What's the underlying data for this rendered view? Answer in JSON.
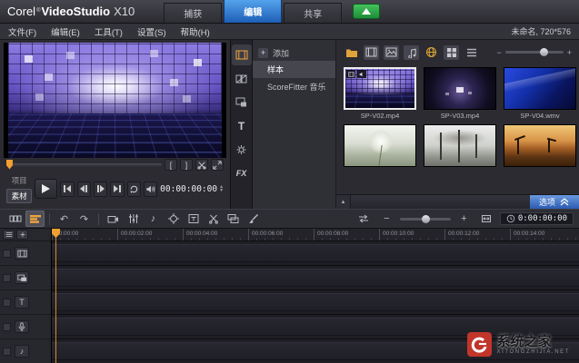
{
  "titlebar": {
    "logo_corel": "Corel",
    "logo_reg": "®",
    "logo_product": "VideoStudio",
    "logo_version": "X10",
    "tabs": [
      {
        "label": "捕获",
        "active": false
      },
      {
        "label": "编辑",
        "active": true
      },
      {
        "label": "共享",
        "active": false
      }
    ]
  },
  "menubar": {
    "items": [
      "文件(F)",
      "编辑(E)",
      "工具(T)",
      "设置(S)",
      "帮助(H)"
    ],
    "project_info": "未命名, 720*576"
  },
  "preview": {
    "mark_in": "[",
    "mark_out": "]",
    "mode_project": "项目",
    "mode_clip": "素材",
    "timecode": "00:00:00:00"
  },
  "library_nav": {
    "title_label": "T",
    "filter_label": "FX"
  },
  "library": {
    "add_label": "添加",
    "folders": [
      {
        "label": "样本"
      },
      {
        "label": "ScoreFitter 音乐"
      }
    ],
    "thumbnails": [
      {
        "name": "SP-V02.mp4",
        "selected": true
      },
      {
        "name": "SP-V03.mp4",
        "selected": false
      },
      {
        "name": "SP-V04.wmv",
        "selected": false
      }
    ],
    "options_label": "选项"
  },
  "timeline_toolbar": {
    "timecode": "0:00:00:00"
  },
  "timeline": {
    "title_track_label": "T",
    "ruler": [
      "00:00:00",
      "00:00:02:00",
      "00:00:04:00",
      "00:00:06:00",
      "00:00:08:00",
      "00:00:10:00",
      "00:00:12:00",
      "00:00:14:00"
    ]
  },
  "watermark": {
    "title": "系统之家",
    "subtitle": "XITONGZHIJIA.NET"
  },
  "icons": {
    "undo": "↶",
    "redo": "↷",
    "note": "♪",
    "up": "▲",
    "down": "▼",
    "plus": "+",
    "minus": "−"
  },
  "colors": {
    "accent_blue": "#2a6fc4",
    "accent_orange": "#f0a43c",
    "accent_green": "#2fae47"
  }
}
